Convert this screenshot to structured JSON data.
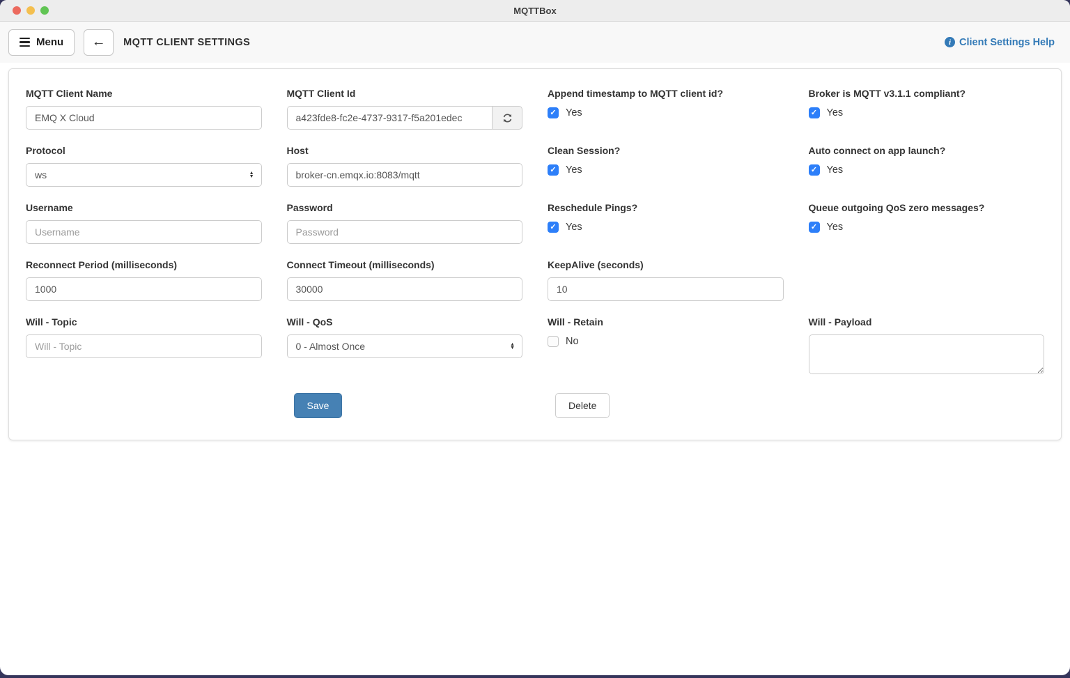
{
  "window": {
    "title": "MQTTBox"
  },
  "toolbar": {
    "menu_label": "Menu",
    "page_title": "MQTT CLIENT SETTINGS",
    "help_label": "Client Settings Help"
  },
  "form": {
    "fields": {
      "client_name": {
        "label": "MQTT Client Name",
        "value": "EMQ X Cloud"
      },
      "client_id": {
        "label": "MQTT Client Id",
        "value": "a423fde8-fc2e-4737-9317-f5a201edec"
      },
      "append_timestamp": {
        "label": "Append timestamp to MQTT client id?",
        "option": "Yes",
        "checked": true
      },
      "broker_compliant": {
        "label": "Broker is MQTT v3.1.1 compliant?",
        "option": "Yes",
        "checked": true
      },
      "protocol": {
        "label": "Protocol",
        "value": "ws"
      },
      "host": {
        "label": "Host",
        "value": "broker-cn.emqx.io:8083/mqtt"
      },
      "clean_session": {
        "label": "Clean Session?",
        "option": "Yes",
        "checked": true
      },
      "auto_connect": {
        "label": "Auto connect on app launch?",
        "option": "Yes",
        "checked": true
      },
      "username": {
        "label": "Username",
        "placeholder": "Username",
        "value": ""
      },
      "password": {
        "label": "Password",
        "placeholder": "Password",
        "value": ""
      },
      "reschedule_pings": {
        "label": "Reschedule Pings?",
        "option": "Yes",
        "checked": true
      },
      "queue_qos_zero": {
        "label": "Queue outgoing QoS zero messages?",
        "option": "Yes",
        "checked": true
      },
      "reconnect_period": {
        "label": "Reconnect Period (milliseconds)",
        "value": "1000"
      },
      "connect_timeout": {
        "label": "Connect Timeout (milliseconds)",
        "value": "30000"
      },
      "keepalive": {
        "label": "KeepAlive (seconds)",
        "value": "10"
      },
      "will_topic": {
        "label": "Will - Topic",
        "placeholder": "Will - Topic",
        "value": ""
      },
      "will_qos": {
        "label": "Will - QoS",
        "value": "0 - Almost Once"
      },
      "will_retain": {
        "label": "Will - Retain",
        "option": "No",
        "checked": false
      },
      "will_payload": {
        "label": "Will - Payload",
        "value": ""
      }
    },
    "buttons": {
      "save": "Save",
      "delete": "Delete"
    }
  },
  "colors": {
    "link_accent": "#337ab7",
    "save_button": "#4681b4",
    "checkbox_checked": "#2d7ff9",
    "desktop_background": "#35355b",
    "titlebar": "#ededed"
  }
}
